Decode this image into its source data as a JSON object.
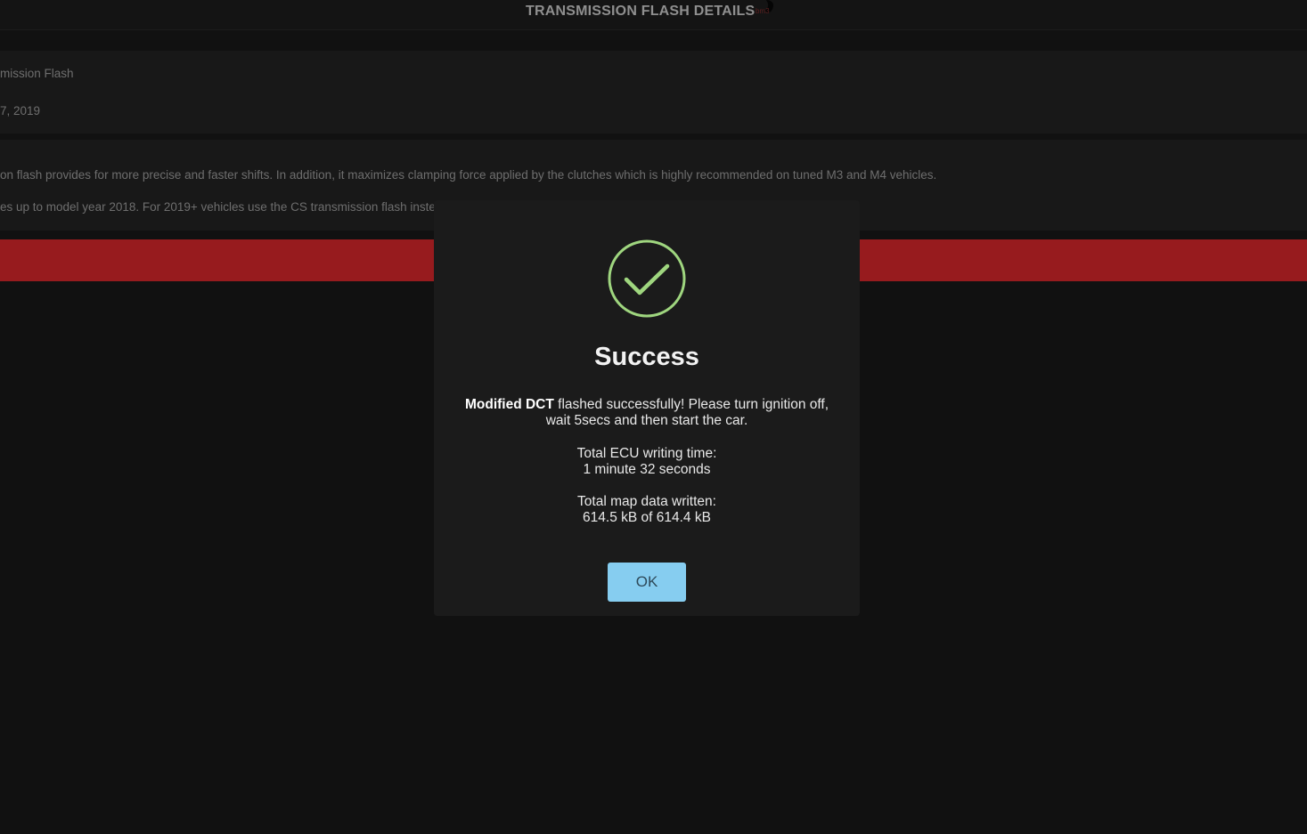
{
  "header": {
    "title": "TRANSMISSION FLASH DETAILS",
    "logo_text": "bm3"
  },
  "background": {
    "flash_name": "mission Flash",
    "date": "7, 2019",
    "description_line1": "on flash provides for more precise and faster shifts. In addition, it maximizes clamping force applied by the clutches which is highly recommended on tuned M3 and M4 vehicles.",
    "description_line2": "es up to model year 2018. For 2019+ vehicles use the CS transmission flash inste",
    "flash_bar_color": "#971b1e"
  },
  "modal": {
    "icon": "checkmark-circle-icon",
    "icon_color": "#9fd67f",
    "title": "Success",
    "message_bold": "Modified DCT",
    "message_line1_rest": " flashed successfully! Please turn ignition off,",
    "message_line2": "wait 5secs and then start the car.",
    "time_label": "Total ECU writing time:",
    "time_value": "1 minute 32 seconds",
    "data_label": "Total map data written:",
    "data_value": "614.5 kB of 614.4 kB",
    "ok_label": "OK",
    "ok_color": "#86cdf0"
  }
}
